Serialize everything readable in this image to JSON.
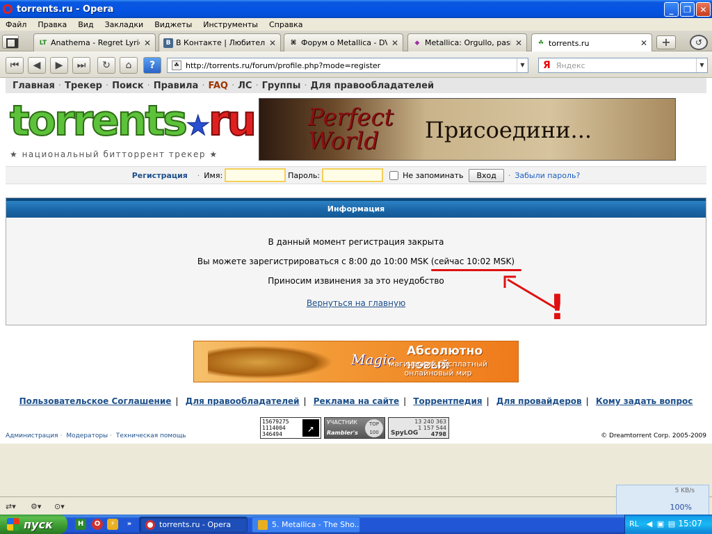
{
  "window": {
    "title": "torrents.ru - Opera",
    "buttons": [
      "_",
      "❐",
      "✕"
    ]
  },
  "menu": [
    "Файл",
    "Правка",
    "Вид",
    "Закладки",
    "Виджеты",
    "Инструменты",
    "Справка"
  ],
  "tabs": [
    {
      "icon": "LT",
      "label": "Anathema - Regret Lyrics",
      "active": false
    },
    {
      "icon": "B",
      "label": "В Контакте | Любител...",
      "active": false
    },
    {
      "icon": "⌘",
      "label": "Форум о Metallica - DVD...",
      "active": false
    },
    {
      "icon": "◆",
      "label": "Metallica: Orgullo, pasio...",
      "active": false
    },
    {
      "icon": "☘",
      "label": "torrents.ru",
      "active": true
    }
  ],
  "address": {
    "url": "http://torrents.ru/forum/profile.php?mode=register"
  },
  "search": {
    "engine": "Я",
    "placeholder": "Яндекс"
  },
  "site": {
    "topnav": [
      "Главная",
      "Трекер",
      "Поиск",
      "Правила",
      "FAQ",
      "ЛС",
      "Группы",
      "Для правообладателей"
    ],
    "logo_main": "torrents",
    "logo_ru": "ru",
    "tagline": "национальный битторрент трекер",
    "banner_top": {
      "brand1": "Perfect",
      "brand2": "World",
      "text": "Присоедини..."
    },
    "login": {
      "register": "Регистрация",
      "name_label": "Имя:",
      "password_label": "Пароль:",
      "remember_label": "Не запоминать",
      "login_button": "Вход",
      "forgot": "Забыли пароль?"
    },
    "info": {
      "header": "Информация",
      "line1": "В данный момент регистрация закрыта",
      "line2": "Вы можете зарегистрироваться с 8:00 до 10:00 MSK (сейчас 10:02 MSK)",
      "line3": "Приносим извинения за это неудобство",
      "back_link": "Вернуться на главную"
    },
    "annotation_mark": "!",
    "banner_mid": {
      "brand": "Magic",
      "title": "Абсолютно новый",
      "subtitle": "магический бесплатный онлайновый мир"
    },
    "footer_links": [
      "Пользовательское Соглашение",
      "Для правообладателей",
      "Реклама на сайте",
      "Торрентпедия",
      "Для провайдеров",
      "Кому задать вопрос"
    ],
    "counters": {
      "c1_lines": [
        "15679275",
        "1114004",
        "346494"
      ],
      "c2_label1": "УЧАСТНИК",
      "c2_label2": "Rambler's",
      "c2_top": "TOP 100",
      "c3_lines": [
        "13 240 363",
        "1 157 544",
        "4798"
      ],
      "c3_brand": "SpyLOG"
    },
    "admin_links": [
      "Администрация",
      "Модераторы",
      "Техническая помощь"
    ],
    "copyright": "© Dreamtorrent Corp. 2005-2009"
  },
  "statusbar": {
    "speed": "5 KB/s",
    "zoom": "100%"
  },
  "taskbar": {
    "start": "пуск",
    "tasks": [
      {
        "label": "torrents.ru - Opera",
        "active": true
      },
      {
        "label": "5. Metallica - The Sho...",
        "active": false
      }
    ],
    "lang": "RL",
    "clock": "15:07"
  }
}
